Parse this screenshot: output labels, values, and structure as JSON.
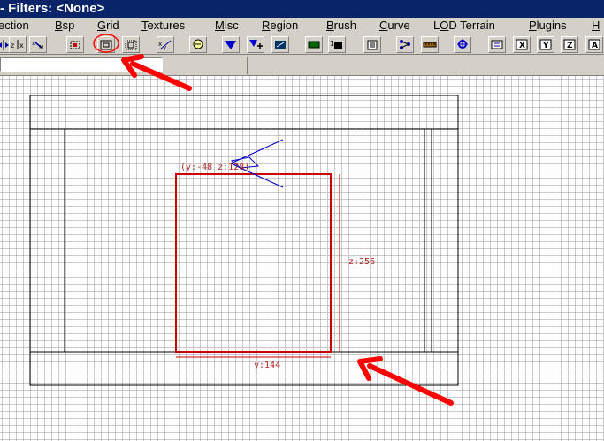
{
  "window": {
    "title": "- Filters: <None>"
  },
  "menu": {
    "items": [
      {
        "pre": "",
        "u": "",
        "post": "ection"
      },
      {
        "pre": "",
        "u": "B",
        "post": "sp"
      },
      {
        "pre": "",
        "u": "G",
        "post": "rid"
      },
      {
        "pre": "",
        "u": "T",
        "post": "extures"
      },
      {
        "pre": "",
        "u": "M",
        "post": "isc"
      },
      {
        "pre": "",
        "u": "R",
        "post": "egion"
      },
      {
        "pre": "",
        "u": "B",
        "post": "rush"
      },
      {
        "pre": "",
        "u": "C",
        "post": "urve"
      },
      {
        "pre": "L",
        "u": "O",
        "post": "D Terrain"
      },
      {
        "pre": "",
        "u": "P",
        "post": "lugins"
      },
      {
        "pre": "",
        "u": "H",
        "post": ""
      }
    ]
  },
  "toolbar": {
    "icons": [
      "flip-x-icon",
      "rotate-x-icon",
      "select-complete-icon",
      "select-inside-icon",
      "select-touching-icon",
      "clip-icon",
      "texture-lock-icon",
      "csg-subtract-icon",
      "csg-merge-icon",
      "make-hollow-icon",
      "patch-icon",
      "cap-icon",
      "view-icon",
      "camera-icon",
      "measure-icon",
      "scale-icon",
      "view-x-icon",
      "view-y-icon",
      "view-z-icon",
      "view-a-icon"
    ],
    "letters": {
      "x": "X",
      "y": "Y",
      "z": "Z",
      "a": "A"
    },
    "highlighted_button": "select-inside-icon"
  },
  "status": {
    "command_value": ""
  },
  "viewport": {
    "labels": {
      "top_coords": "(y:-48  z:128)",
      "height_dim": "z:256",
      "width_dim": "y:144"
    }
  },
  "colors": {
    "title_bg": "#0a246a",
    "face": "#d4d0c8",
    "brush_selected": "#cc0000",
    "annotation_arrow": "#ff0000",
    "camera": "#0000cc"
  }
}
